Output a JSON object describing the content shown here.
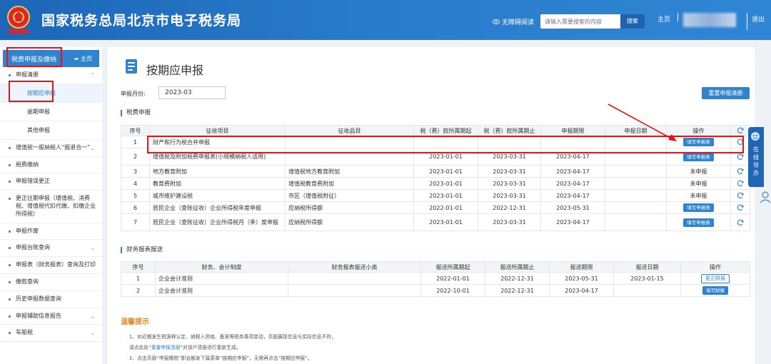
{
  "header": {
    "site_title": "国家税务总局北京市电子税务局",
    "accessibility": "无障碍阅读",
    "search_placeholder": "请输入需要搜索的内容",
    "search_button": "搜索",
    "home": "主页",
    "logout": "退出"
  },
  "sidebar": {
    "title": "税费申报及缴纳",
    "home": "主页",
    "items": [
      {
        "label": "申报清册"
      },
      {
        "label": "增值税一般纳税人“报退合一”"
      },
      {
        "label": "税费缴纳"
      },
      {
        "label": "申报错误更正"
      },
      {
        "label": "更正往期申报（增值税、消费税、增值税代扣代缴、扣缴企业所得税）"
      },
      {
        "label": "申报作废"
      },
      {
        "label": "申报台账查询"
      },
      {
        "label": "申报表（财务报表）查询及打印"
      },
      {
        "label": "缴款查询"
      },
      {
        "label": "历史申报数据查询"
      },
      {
        "label": "申报辅助信息报告"
      },
      {
        "label": "车船税"
      }
    ],
    "subitems": [
      {
        "label": "按期应申报"
      },
      {
        "label": "逾期申报"
      },
      {
        "label": "其他申报"
      }
    ]
  },
  "main": {
    "page_title": "按期应申报",
    "period_label": "申报月份:",
    "period_value": "2023-03",
    "reset_button": "重置申报清册",
    "tax_section_title": "税费申报",
    "tax_table": {
      "headers": [
        "序号",
        "征收项目",
        "征收品目",
        "税（费）款所属期起",
        "税（费）款所属期止",
        "申报期限",
        "申报日期",
        "操作",
        ""
      ],
      "rows": [
        {
          "no": "1",
          "item": "财产和行为税合并申报",
          "subitem": "",
          "start": "",
          "end": "",
          "deadline": "",
          "date": "",
          "op": "填写申报表"
        },
        {
          "no": "2",
          "item": "增值税及附加税费申报表(小规模纳税人适用)",
          "subitem": "",
          "start": "2023-01-01",
          "end": "2023-03-31",
          "deadline": "2023-04-17",
          "date": "",
          "op": "填写申报表"
        },
        {
          "no": "3",
          "item": "地方教育附加",
          "subitem": "增值税地方教育附加",
          "start": "2023-01-01",
          "end": "2023-03-31",
          "deadline": "2023-04-17",
          "date": "",
          "op": "未申报"
        },
        {
          "no": "4",
          "item": "教育费附加",
          "subitem": "增值税教育费附加",
          "start": "2023-01-01",
          "end": "2023-03-31",
          "deadline": "2023-04-17",
          "date": "",
          "op": "未申报"
        },
        {
          "no": "5",
          "item": "城市维护建设税",
          "subitem": "市区（增值税附征）",
          "start": "2023-01-01",
          "end": "2023-03-31",
          "deadline": "2023-04-17",
          "date": "",
          "op": "未申报"
        },
        {
          "no": "6",
          "item": "居民企业（查账征收）企业所得税年度申报",
          "subitem": "应纳税所得额",
          "start": "2022-01-01",
          "end": "2022-12-31",
          "deadline": "2023-05-31",
          "date": "",
          "op": "填写申报表"
        },
        {
          "no": "7",
          "item": "居民企业（查账征收）企业所得税月（季）度申报",
          "subitem": "应纳税所得额",
          "start": "2023-01-01",
          "end": "2023-03-31",
          "deadline": "2023-04-17",
          "date": "",
          "op": "填写申报表"
        }
      ]
    },
    "fin_section_title": "财务报表报送",
    "fin_table": {
      "headers": [
        "序号",
        "财务、会计制度",
        "财务报表报送小类",
        "报送所属期起",
        "报送所属期止",
        "报送期限",
        "报送日期",
        "操作"
      ],
      "rows": [
        {
          "no": "1",
          "system": "企业会计准则",
          "type": "",
          "start": "2022-01-01",
          "end": "2022-12-31",
          "deadline": "2023-05-31",
          "date": "2023-01-15",
          "op": "更正财报"
        },
        {
          "no": "2",
          "system": "企业会计准则",
          "type": "",
          "start": "2022-10-01",
          "end": "2022-12-31",
          "deadline": "2023-04-17",
          "date": "",
          "op": "填写财报"
        }
      ]
    },
    "tips": {
      "title": "温馨提示",
      "line1": "1、如近期发生税源种认定、纳税人资格、备案等税务事项变动，页面展现信息与实际信息不符，",
      "line2_pre": "请点此处“",
      "line2_link": "重置申报清册",
      "line2_post": "”对该户清册进行重新生成。",
      "line3": "2、点击页眉“申报缴税”即会触发下属菜单“按期应申报”，无需再点击“按期应申报”。"
    }
  },
  "float": {
    "label": "在线导办"
  },
  "colors": {
    "primary": "#2f83cf",
    "header": "#1d66b8",
    "annotation": "#e11111",
    "tips": "#e38a2c"
  }
}
